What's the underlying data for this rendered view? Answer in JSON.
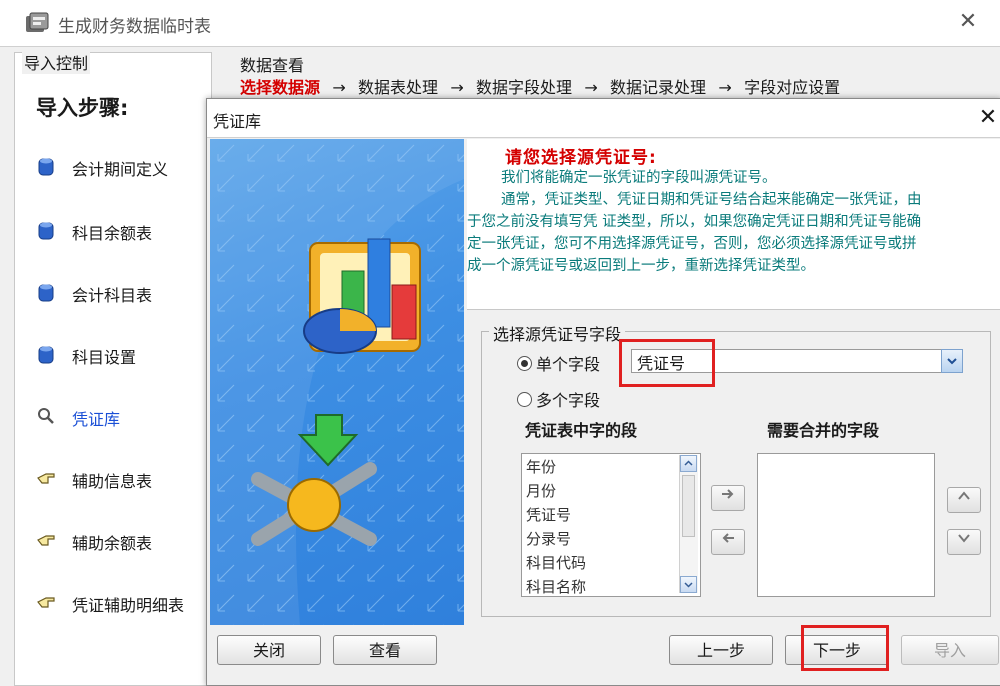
{
  "window": {
    "title": "生成财务数据临时表",
    "close_glyph": "✕"
  },
  "left_panel": {
    "group_label": "导入控制",
    "heading": "导入步骤:",
    "steps": [
      {
        "label": "会计期间定义",
        "icon": "cylinder-icon"
      },
      {
        "label": "科目余额表",
        "icon": "cylinder-icon"
      },
      {
        "label": "会计科目表",
        "icon": "cylinder-icon"
      },
      {
        "label": "科目设置",
        "icon": "cylinder-icon"
      },
      {
        "label": "凭证库",
        "icon": "magnifier-icon",
        "active": true
      },
      {
        "label": "辅助信息表",
        "icon": "pointing-hand-icon"
      },
      {
        "label": "辅助余额表",
        "icon": "pointing-hand-icon"
      },
      {
        "label": "凭证辅助明细表",
        "icon": "pointing-hand-icon"
      }
    ]
  },
  "data_view": {
    "label": "数据查看",
    "progress": [
      "选择数据源",
      "数据表处理",
      "数据字段处理",
      "数据记录处理",
      "字段对应设置"
    ],
    "arrow": "→"
  },
  "dialog": {
    "title": "凭证库",
    "close_glyph": "✕",
    "instructions": {
      "heading": "请您选择源凭证号:",
      "lines": [
        "我们将能确定一张凭证的字段叫源凭证号。",
        "通常，凭证类型、凭证日期和凭证号结合起来能确定一张凭证，由",
        "于您之前没有填写凭 证类型，所以，如果您确定凭证日期和凭证号能确",
        "定一张凭证，您可不用选择源凭证号，否则，您必须选择源凭证号或拼",
        "成一个源凭证号或返回到上一步，重新选择凭证类型。"
      ]
    },
    "field_group": {
      "label": "选择源凭证号字段",
      "single_field_label": "单个字段",
      "multi_field_label": "多个字段",
      "selected_field": "凭证号",
      "source_fields_label": "凭证表中字的段",
      "merge_fields_label": "需要合并的字段",
      "source_fields": [
        "年份",
        "月份",
        "凭证号",
        "分录号",
        "科目代码",
        "科目名称"
      ],
      "merge_fields": []
    },
    "buttons": {
      "close": "关闭",
      "view": "查看",
      "prev": "上一步",
      "next": "下一步",
      "import": "导入"
    }
  },
  "colors": {
    "accent_red": "#d40000",
    "instruction_teal": "#0a7b7b",
    "highlight_red": "#e02020",
    "wizard_blue": "#3d8ee3"
  }
}
